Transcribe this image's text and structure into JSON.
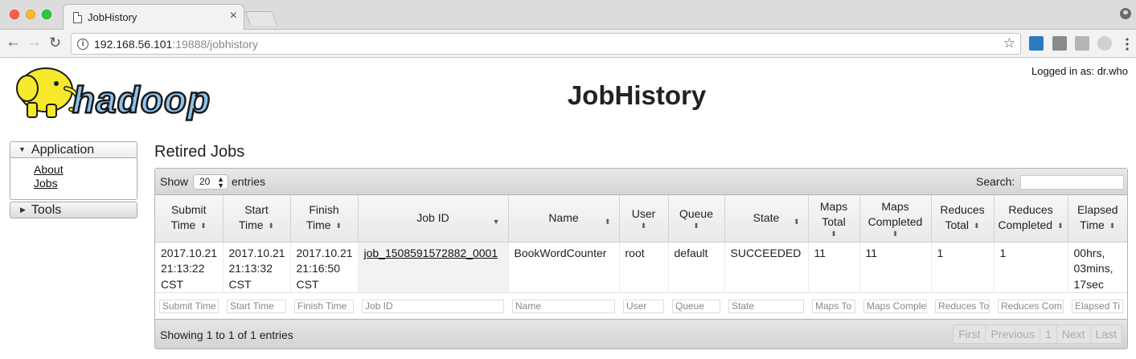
{
  "browser": {
    "tab_title": "JobHistory",
    "url_host": "192.168.56.101",
    "url_path": ":19888/jobhistory"
  },
  "header": {
    "title": "JobHistory",
    "logged_in": "Logged in as: dr.who",
    "logo_text": "hadoop"
  },
  "nav": {
    "application_label": "Application",
    "links": [
      "About",
      "Jobs"
    ],
    "tools_label": "Tools"
  },
  "main": {
    "section_title": "Retired Jobs",
    "show_label": "Show",
    "page_size": "20",
    "entries_label": "entries",
    "search_label": "Search:",
    "columns": [
      [
        "Submit",
        "Time"
      ],
      [
        "Start",
        "Time"
      ],
      [
        "Finish",
        "Time"
      ],
      [
        "Job ID"
      ],
      [
        "Name"
      ],
      [
        "User"
      ],
      [
        "Queue"
      ],
      [
        "State"
      ],
      [
        "Maps",
        "Total"
      ],
      [
        "Maps",
        "Completed"
      ],
      [
        "Reduces",
        "Total"
      ],
      [
        "Reduces",
        "Completed"
      ],
      [
        "Elapsed",
        "Time"
      ]
    ],
    "rows": [
      {
        "submit_time": [
          "2017.10.21",
          "21:13:22",
          "CST"
        ],
        "start_time": [
          "2017.10.21",
          "21:13:32",
          "CST"
        ],
        "finish_time": [
          "2017.10.21",
          "21:16:50",
          "CST"
        ],
        "job_id": "job_1508591572882_0001",
        "name": "BookWordCounter",
        "user": "root",
        "queue": "default",
        "state": "SUCCEEDED",
        "maps_total": "11",
        "maps_completed": "11",
        "reduces_total": "1",
        "reduces_completed": "1",
        "elapsed": [
          "00hrs,",
          "03mins,",
          "17sec"
        ]
      }
    ],
    "filters": [
      "Submit Time",
      "Start Time",
      "Finish Time",
      "Job ID",
      "Name",
      "User",
      "Queue",
      "State",
      "Maps To",
      "Maps Comple",
      "Reduces To",
      "Reduces Com",
      "Elapsed Ti"
    ],
    "info_text": "Showing 1 to 1 of 1 entries",
    "paging": [
      "First",
      "Previous",
      "1",
      "Next",
      "Last"
    ]
  },
  "colors": {
    "header_gradient_top": "#f7f7f7",
    "header_gradient_bottom": "#e9e9e9",
    "toolbar_gradient_bottom": "#d5d5d5",
    "logo_blue": "#1f5fa8",
    "logo_yellow": "#f6e92c"
  }
}
